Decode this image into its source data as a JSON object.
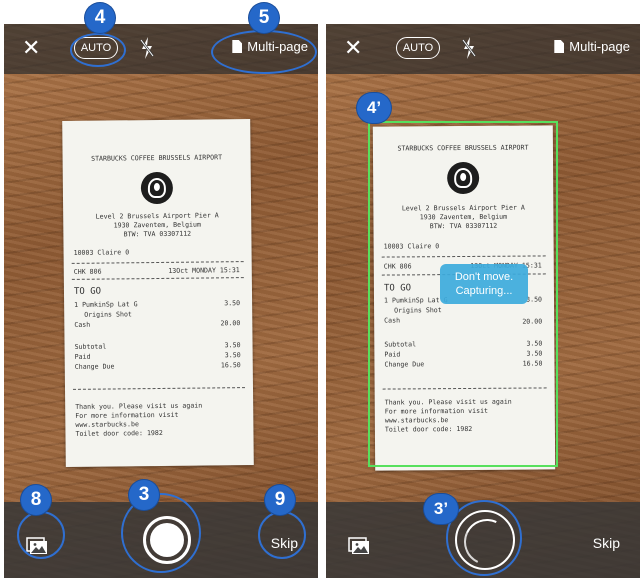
{
  "screens": {
    "left": {
      "topbar": {
        "close_glyph": "✕",
        "auto_label": "AUTO",
        "flash_icon": "flash-off-icon",
        "multipage_label": "Multi-page"
      },
      "bottombar": {
        "gallery_icon": "gallery-icon",
        "skip_label": "Skip"
      }
    },
    "right": {
      "topbar": {
        "close_glyph": "✕",
        "auto_label": "AUTO",
        "flash_icon": "flash-off-icon",
        "multipage_label": "Multi-page"
      },
      "toast": {
        "line1": "Don't move.",
        "line2": "Capturing..."
      },
      "bottombar": {
        "gallery_icon": "gallery-icon",
        "skip_label": "Skip"
      }
    }
  },
  "receipt": {
    "header": "STARBUCKS COFFEE BRUSSELS AIRPORT",
    "address1": "Level 2 Brussels Airport Pier A",
    "address2": "1930 Zaventem, Belgium",
    "vat": "BTW: TVA 03307112",
    "order": "10003 Claire 0",
    "check": "CHK 806",
    "date": "13Oct MONDAY 15:31",
    "to_go": "TO GO",
    "item1": "1 PumkinSp Lat G",
    "item1_price": "3.50",
    "item2": "Origins Shot",
    "cash_label": "Cash",
    "cash_value": "20.00",
    "subtotal_label": "Subtotal",
    "subtotal_value": "3.50",
    "paid_label": "Paid",
    "paid_value": "3.50",
    "change_label": "Change Due",
    "change_value": "16.50",
    "thanks1": "Thank you. Please visit us again",
    "thanks2": "For more information visit",
    "thanks3": "www.starbucks.be",
    "thanks4": "Toilet door code: 1982"
  },
  "annotations": {
    "b4": "4",
    "b5": "5",
    "b3": "3",
    "b8": "8",
    "b9": "9",
    "b4p": "4’",
    "b3p": "3’"
  },
  "colors": {
    "badge": "#2568c9",
    "detect_border": "#57e05d",
    "toast": "#3caadc"
  }
}
